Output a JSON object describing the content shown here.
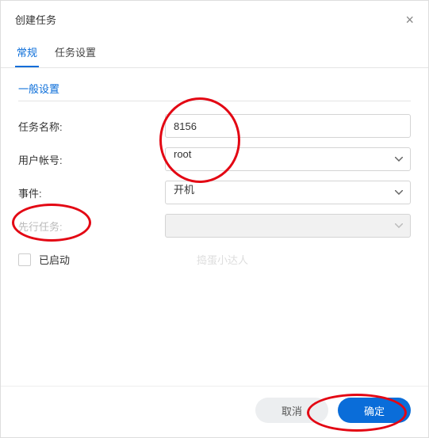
{
  "modal": {
    "title": "创建任务",
    "close": "×"
  },
  "tabs": {
    "general": "常规",
    "settings": "任务设置"
  },
  "section": {
    "title": "一般设置"
  },
  "fields": {
    "task_name": {
      "label": "任务名称:",
      "value": "8156"
    },
    "user": {
      "label": "用户帐号:",
      "value": "root"
    },
    "event": {
      "label": "事件:",
      "value": "开机"
    },
    "pre_task": {
      "label": "先行任务:",
      "value": ""
    },
    "enabled": {
      "label": "已启动"
    }
  },
  "watermark": "捣蛋小达人",
  "footer": {
    "cancel": "取消",
    "ok": "确定"
  }
}
